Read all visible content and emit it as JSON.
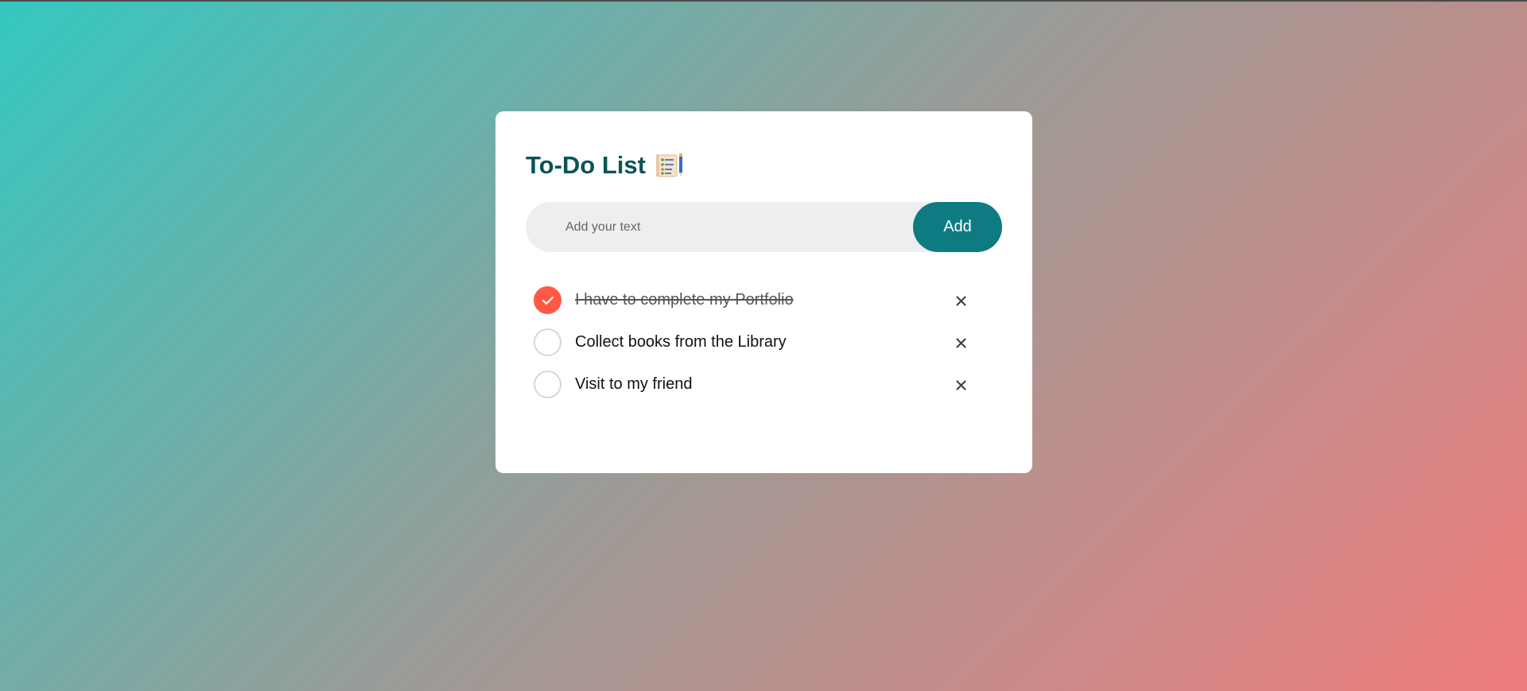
{
  "app": {
    "title": "To-Do List"
  },
  "input": {
    "placeholder": "Add your text",
    "value": ""
  },
  "add_button": {
    "label": "Add"
  },
  "tasks": [
    {
      "text": "I have to complete my Portfolio",
      "done": true
    },
    {
      "text": "Collect books from the Library",
      "done": false
    },
    {
      "text": "Visit to my friend",
      "done": false
    }
  ],
  "colors": {
    "accent": "#0e7b83",
    "title": "#0b5456",
    "checked": "#ff5945"
  },
  "icons": {
    "title_icon": "checklist-icon",
    "check_icon": "checkmark-icon",
    "remove_icon": "close-icon"
  }
}
